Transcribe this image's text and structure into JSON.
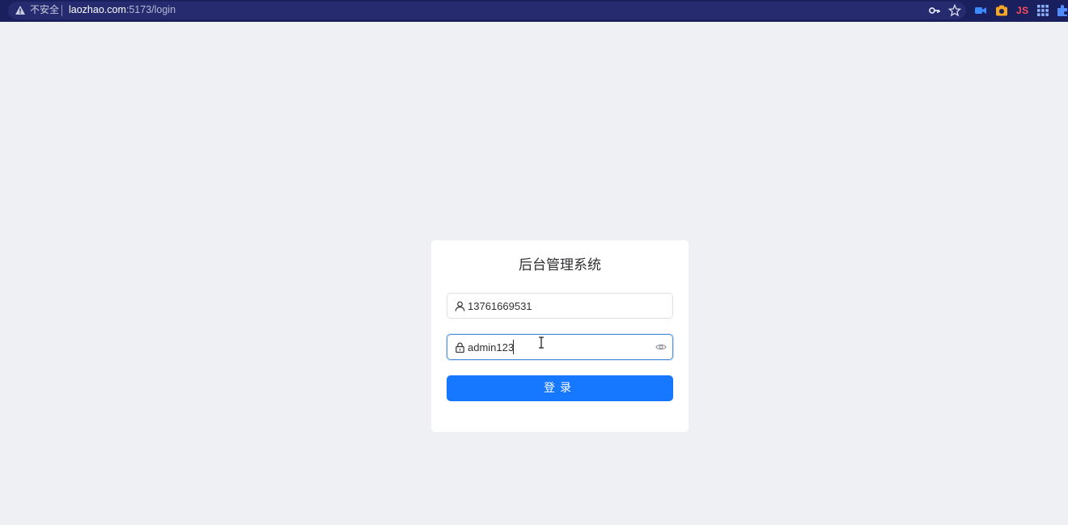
{
  "browser": {
    "security_label": "不安全",
    "url_host": "laozhao.com",
    "url_path": ":5173/login",
    "icons": [
      "warning-icon",
      "key-icon",
      "star-icon",
      "video-ext-icon",
      "camera-ext-icon",
      "js-ext-icon",
      "grid-ext-icon",
      "puzzle-ext-icon"
    ],
    "js_ext_label": "JS"
  },
  "login": {
    "title": "后台管理系统",
    "username_value": "13761669531",
    "password_value": "admin123",
    "submit_label": "登录"
  },
  "colors": {
    "page_bg": "#eff0f3",
    "browser_bar": "#1a1f5e",
    "primary": "#1677ff",
    "focus_border": "#4a90e2"
  }
}
